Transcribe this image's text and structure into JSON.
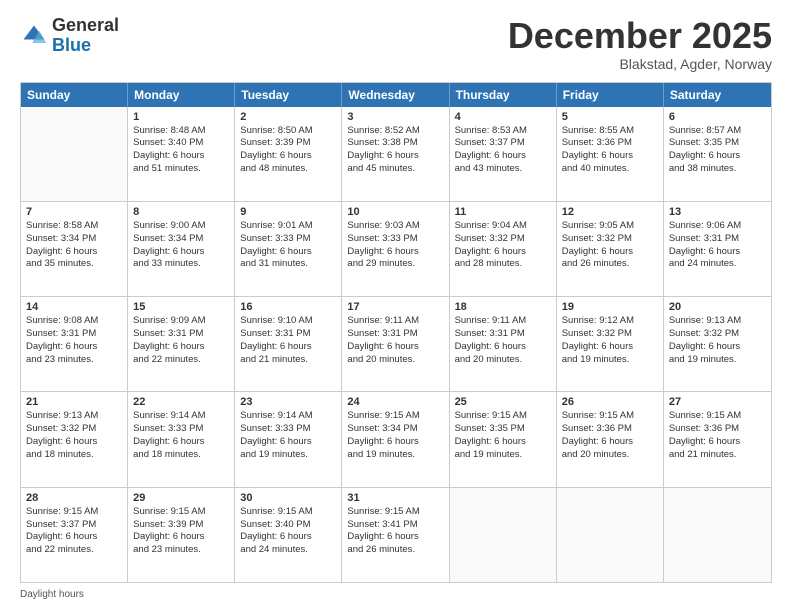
{
  "logo": {
    "general": "General",
    "blue": "Blue"
  },
  "title": "December 2025",
  "subtitle": "Blakstad, Agder, Norway",
  "footer": "Daylight hours",
  "days": [
    "Sunday",
    "Monday",
    "Tuesday",
    "Wednesday",
    "Thursday",
    "Friday",
    "Saturday"
  ],
  "weeks": [
    [
      {
        "day": "",
        "info": ""
      },
      {
        "day": "1",
        "info": "Sunrise: 8:48 AM\nSunset: 3:40 PM\nDaylight: 6 hours\nand 51 minutes."
      },
      {
        "day": "2",
        "info": "Sunrise: 8:50 AM\nSunset: 3:39 PM\nDaylight: 6 hours\nand 48 minutes."
      },
      {
        "day": "3",
        "info": "Sunrise: 8:52 AM\nSunset: 3:38 PM\nDaylight: 6 hours\nand 45 minutes."
      },
      {
        "day": "4",
        "info": "Sunrise: 8:53 AM\nSunset: 3:37 PM\nDaylight: 6 hours\nand 43 minutes."
      },
      {
        "day": "5",
        "info": "Sunrise: 8:55 AM\nSunset: 3:36 PM\nDaylight: 6 hours\nand 40 minutes."
      },
      {
        "day": "6",
        "info": "Sunrise: 8:57 AM\nSunset: 3:35 PM\nDaylight: 6 hours\nand 38 minutes."
      }
    ],
    [
      {
        "day": "7",
        "info": "Sunrise: 8:58 AM\nSunset: 3:34 PM\nDaylight: 6 hours\nand 35 minutes."
      },
      {
        "day": "8",
        "info": "Sunrise: 9:00 AM\nSunset: 3:34 PM\nDaylight: 6 hours\nand 33 minutes."
      },
      {
        "day": "9",
        "info": "Sunrise: 9:01 AM\nSunset: 3:33 PM\nDaylight: 6 hours\nand 31 minutes."
      },
      {
        "day": "10",
        "info": "Sunrise: 9:03 AM\nSunset: 3:33 PM\nDaylight: 6 hours\nand 29 minutes."
      },
      {
        "day": "11",
        "info": "Sunrise: 9:04 AM\nSunset: 3:32 PM\nDaylight: 6 hours\nand 28 minutes."
      },
      {
        "day": "12",
        "info": "Sunrise: 9:05 AM\nSunset: 3:32 PM\nDaylight: 6 hours\nand 26 minutes."
      },
      {
        "day": "13",
        "info": "Sunrise: 9:06 AM\nSunset: 3:31 PM\nDaylight: 6 hours\nand 24 minutes."
      }
    ],
    [
      {
        "day": "14",
        "info": "Sunrise: 9:08 AM\nSunset: 3:31 PM\nDaylight: 6 hours\nand 23 minutes."
      },
      {
        "day": "15",
        "info": "Sunrise: 9:09 AM\nSunset: 3:31 PM\nDaylight: 6 hours\nand 22 minutes."
      },
      {
        "day": "16",
        "info": "Sunrise: 9:10 AM\nSunset: 3:31 PM\nDaylight: 6 hours\nand 21 minutes."
      },
      {
        "day": "17",
        "info": "Sunrise: 9:11 AM\nSunset: 3:31 PM\nDaylight: 6 hours\nand 20 minutes."
      },
      {
        "day": "18",
        "info": "Sunrise: 9:11 AM\nSunset: 3:31 PM\nDaylight: 6 hours\nand 20 minutes."
      },
      {
        "day": "19",
        "info": "Sunrise: 9:12 AM\nSunset: 3:32 PM\nDaylight: 6 hours\nand 19 minutes."
      },
      {
        "day": "20",
        "info": "Sunrise: 9:13 AM\nSunset: 3:32 PM\nDaylight: 6 hours\nand 19 minutes."
      }
    ],
    [
      {
        "day": "21",
        "info": "Sunrise: 9:13 AM\nSunset: 3:32 PM\nDaylight: 6 hours\nand 18 minutes."
      },
      {
        "day": "22",
        "info": "Sunrise: 9:14 AM\nSunset: 3:33 PM\nDaylight: 6 hours\nand 18 minutes."
      },
      {
        "day": "23",
        "info": "Sunrise: 9:14 AM\nSunset: 3:33 PM\nDaylight: 6 hours\nand 19 minutes."
      },
      {
        "day": "24",
        "info": "Sunrise: 9:15 AM\nSunset: 3:34 PM\nDaylight: 6 hours\nand 19 minutes."
      },
      {
        "day": "25",
        "info": "Sunrise: 9:15 AM\nSunset: 3:35 PM\nDaylight: 6 hours\nand 19 minutes."
      },
      {
        "day": "26",
        "info": "Sunrise: 9:15 AM\nSunset: 3:36 PM\nDaylight: 6 hours\nand 20 minutes."
      },
      {
        "day": "27",
        "info": "Sunrise: 9:15 AM\nSunset: 3:36 PM\nDaylight: 6 hours\nand 21 minutes."
      }
    ],
    [
      {
        "day": "28",
        "info": "Sunrise: 9:15 AM\nSunset: 3:37 PM\nDaylight: 6 hours\nand 22 minutes."
      },
      {
        "day": "29",
        "info": "Sunrise: 9:15 AM\nSunset: 3:39 PM\nDaylight: 6 hours\nand 23 minutes."
      },
      {
        "day": "30",
        "info": "Sunrise: 9:15 AM\nSunset: 3:40 PM\nDaylight: 6 hours\nand 24 minutes."
      },
      {
        "day": "31",
        "info": "Sunrise: 9:15 AM\nSunset: 3:41 PM\nDaylight: 6 hours\nand 26 minutes."
      },
      {
        "day": "",
        "info": ""
      },
      {
        "day": "",
        "info": ""
      },
      {
        "day": "",
        "info": ""
      }
    ]
  ]
}
